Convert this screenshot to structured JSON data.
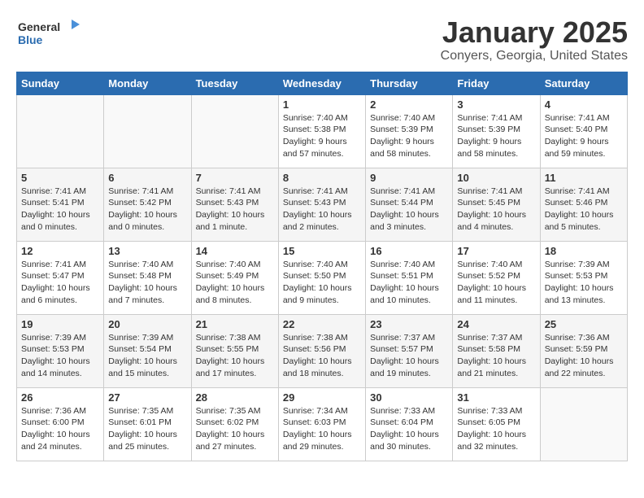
{
  "header": {
    "logo_general": "General",
    "logo_blue": "Blue",
    "month": "January 2025",
    "location": "Conyers, Georgia, United States"
  },
  "weekdays": [
    "Sunday",
    "Monday",
    "Tuesday",
    "Wednesday",
    "Thursday",
    "Friday",
    "Saturday"
  ],
  "weeks": [
    [
      {
        "day": "",
        "info": ""
      },
      {
        "day": "",
        "info": ""
      },
      {
        "day": "",
        "info": ""
      },
      {
        "day": "1",
        "info": "Sunrise: 7:40 AM\nSunset: 5:38 PM\nDaylight: 9 hours and 57 minutes."
      },
      {
        "day": "2",
        "info": "Sunrise: 7:40 AM\nSunset: 5:39 PM\nDaylight: 9 hours and 58 minutes."
      },
      {
        "day": "3",
        "info": "Sunrise: 7:41 AM\nSunset: 5:39 PM\nDaylight: 9 hours and 58 minutes."
      },
      {
        "day": "4",
        "info": "Sunrise: 7:41 AM\nSunset: 5:40 PM\nDaylight: 9 hours and 59 minutes."
      }
    ],
    [
      {
        "day": "5",
        "info": "Sunrise: 7:41 AM\nSunset: 5:41 PM\nDaylight: 10 hours and 0 minutes."
      },
      {
        "day": "6",
        "info": "Sunrise: 7:41 AM\nSunset: 5:42 PM\nDaylight: 10 hours and 0 minutes."
      },
      {
        "day": "7",
        "info": "Sunrise: 7:41 AM\nSunset: 5:43 PM\nDaylight: 10 hours and 1 minute."
      },
      {
        "day": "8",
        "info": "Sunrise: 7:41 AM\nSunset: 5:43 PM\nDaylight: 10 hours and 2 minutes."
      },
      {
        "day": "9",
        "info": "Sunrise: 7:41 AM\nSunset: 5:44 PM\nDaylight: 10 hours and 3 minutes."
      },
      {
        "day": "10",
        "info": "Sunrise: 7:41 AM\nSunset: 5:45 PM\nDaylight: 10 hours and 4 minutes."
      },
      {
        "day": "11",
        "info": "Sunrise: 7:41 AM\nSunset: 5:46 PM\nDaylight: 10 hours and 5 minutes."
      }
    ],
    [
      {
        "day": "12",
        "info": "Sunrise: 7:41 AM\nSunset: 5:47 PM\nDaylight: 10 hours and 6 minutes."
      },
      {
        "day": "13",
        "info": "Sunrise: 7:40 AM\nSunset: 5:48 PM\nDaylight: 10 hours and 7 minutes."
      },
      {
        "day": "14",
        "info": "Sunrise: 7:40 AM\nSunset: 5:49 PM\nDaylight: 10 hours and 8 minutes."
      },
      {
        "day": "15",
        "info": "Sunrise: 7:40 AM\nSunset: 5:50 PM\nDaylight: 10 hours and 9 minutes."
      },
      {
        "day": "16",
        "info": "Sunrise: 7:40 AM\nSunset: 5:51 PM\nDaylight: 10 hours and 10 minutes."
      },
      {
        "day": "17",
        "info": "Sunrise: 7:40 AM\nSunset: 5:52 PM\nDaylight: 10 hours and 11 minutes."
      },
      {
        "day": "18",
        "info": "Sunrise: 7:39 AM\nSunset: 5:53 PM\nDaylight: 10 hours and 13 minutes."
      }
    ],
    [
      {
        "day": "19",
        "info": "Sunrise: 7:39 AM\nSunset: 5:53 PM\nDaylight: 10 hours and 14 minutes."
      },
      {
        "day": "20",
        "info": "Sunrise: 7:39 AM\nSunset: 5:54 PM\nDaylight: 10 hours and 15 minutes."
      },
      {
        "day": "21",
        "info": "Sunrise: 7:38 AM\nSunset: 5:55 PM\nDaylight: 10 hours and 17 minutes."
      },
      {
        "day": "22",
        "info": "Sunrise: 7:38 AM\nSunset: 5:56 PM\nDaylight: 10 hours and 18 minutes."
      },
      {
        "day": "23",
        "info": "Sunrise: 7:37 AM\nSunset: 5:57 PM\nDaylight: 10 hours and 19 minutes."
      },
      {
        "day": "24",
        "info": "Sunrise: 7:37 AM\nSunset: 5:58 PM\nDaylight: 10 hours and 21 minutes."
      },
      {
        "day": "25",
        "info": "Sunrise: 7:36 AM\nSunset: 5:59 PM\nDaylight: 10 hours and 22 minutes."
      }
    ],
    [
      {
        "day": "26",
        "info": "Sunrise: 7:36 AM\nSunset: 6:00 PM\nDaylight: 10 hours and 24 minutes."
      },
      {
        "day": "27",
        "info": "Sunrise: 7:35 AM\nSunset: 6:01 PM\nDaylight: 10 hours and 25 minutes."
      },
      {
        "day": "28",
        "info": "Sunrise: 7:35 AM\nSunset: 6:02 PM\nDaylight: 10 hours and 27 minutes."
      },
      {
        "day": "29",
        "info": "Sunrise: 7:34 AM\nSunset: 6:03 PM\nDaylight: 10 hours and 29 minutes."
      },
      {
        "day": "30",
        "info": "Sunrise: 7:33 AM\nSunset: 6:04 PM\nDaylight: 10 hours and 30 minutes."
      },
      {
        "day": "31",
        "info": "Sunrise: 7:33 AM\nSunset: 6:05 PM\nDaylight: 10 hours and 32 minutes."
      },
      {
        "day": "",
        "info": ""
      }
    ]
  ]
}
